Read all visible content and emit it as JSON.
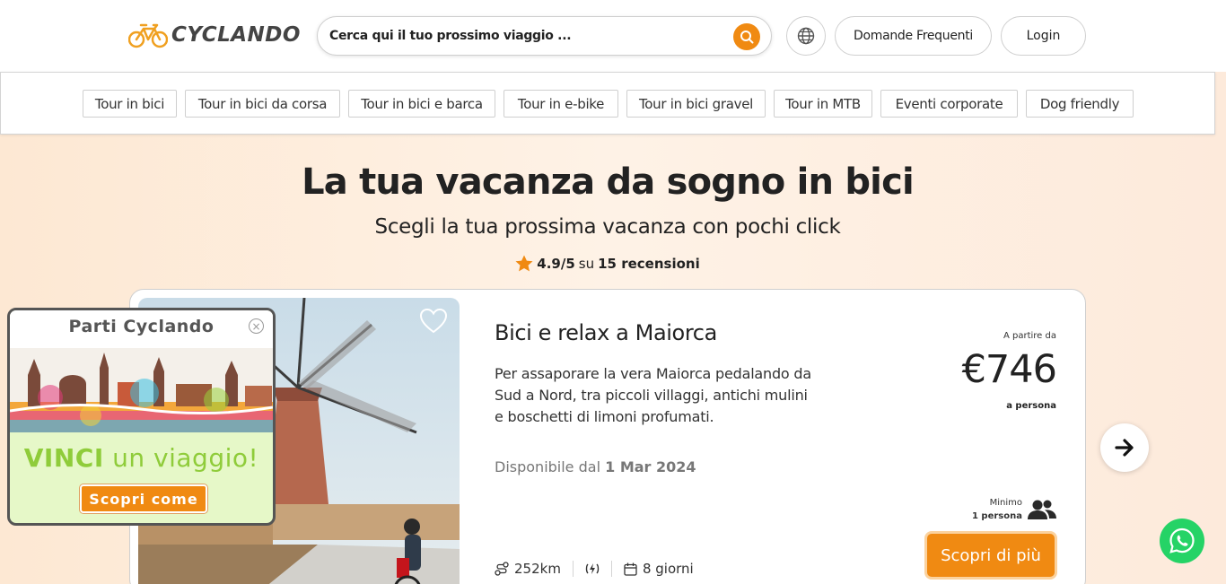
{
  "brand": {
    "name": "CYCLANDO",
    "accent": "#f08a12"
  },
  "search": {
    "placeholder": "Cerca qui il tuo prossimo viaggio ..."
  },
  "nav": {
    "faq": "Domande Frequenti",
    "login": "Login"
  },
  "categories": [
    "Tour in bici",
    "Tour in bici da corsa",
    "Tour in bici e barca",
    "Tour in e-bike",
    "Tour in bici gravel",
    "Tour in MTB",
    "Eventi corporate",
    "Dog friendly"
  ],
  "hero": {
    "title": "La tua vacanza da sogno in bici",
    "subtitle": "Scegli la tua prossima vacanza con pochi click",
    "rating": "4.9/5",
    "rating_su": "su",
    "reviews": "15 recensioni"
  },
  "card": {
    "badge": "one",
    "title": "Bici e relax a Maiorca",
    "description": "Per assaporare la vera Maiorca pedalando da Sud a Nord, tra piccoli villaggi, antichi mulini e boschetti di limoni profumati.",
    "available_prefix": "Disponibile dal",
    "available_date": "1 Mar 2024",
    "price_from": "A partire da",
    "price": "€746",
    "price_unit": "a persona",
    "min_label": "Minimo",
    "min_value": "1 persona",
    "cta": "Scopri di più",
    "distance": "252km",
    "duration": "8 giorni"
  },
  "promo": {
    "title": "Parti Cyclando",
    "win_strong": "VINCI",
    "win_rest": "un viaggio!",
    "cta": "Scopri come"
  },
  "icons": [
    "search-icon",
    "globe-icon",
    "star-icon",
    "heart-icon",
    "users-icon",
    "route-icon",
    "ebike-icon",
    "calendar-icon",
    "arrow-right-icon",
    "whatsapp-icon",
    "close-icon"
  ]
}
